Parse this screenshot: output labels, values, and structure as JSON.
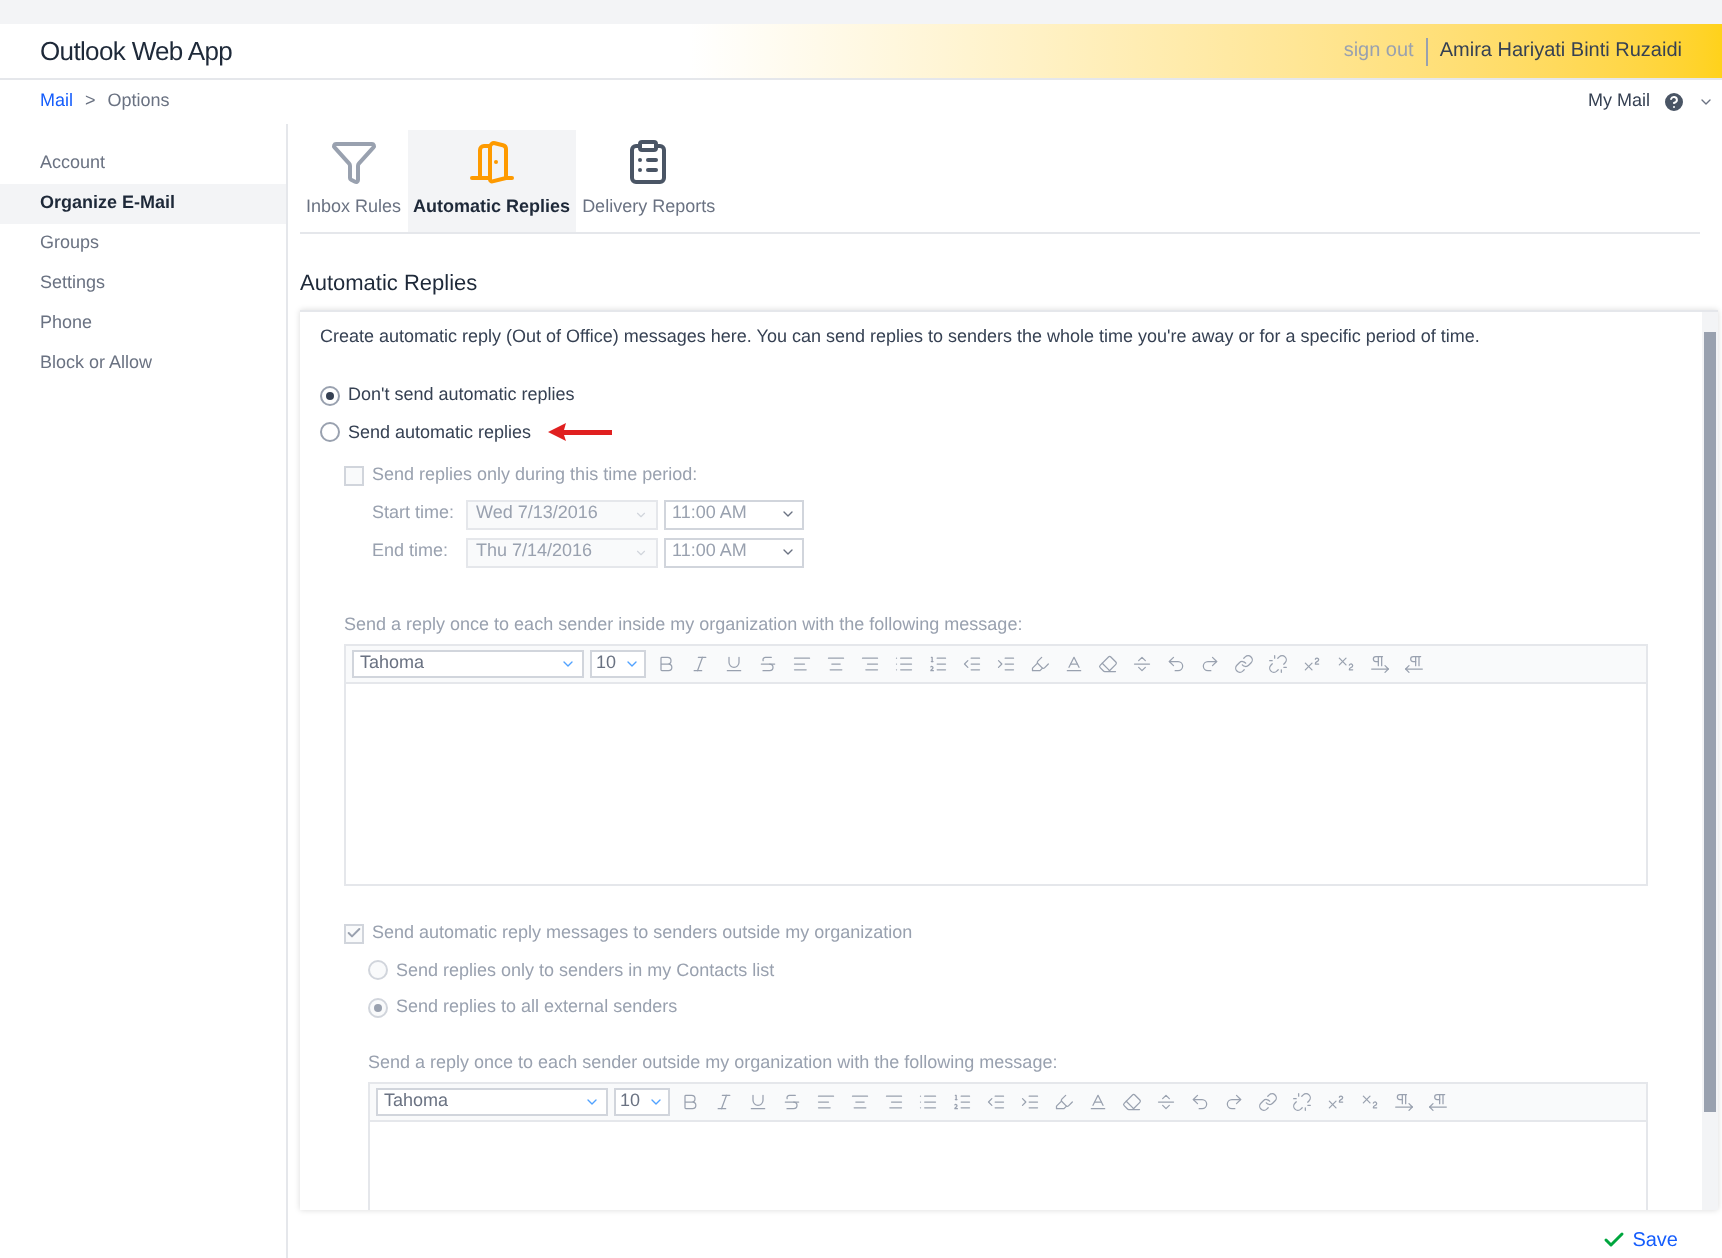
{
  "header": {
    "brand": "Outlook Web App",
    "sign_out": "sign out",
    "user": "Amira Hariyati Binti Ruzaidi"
  },
  "breadcrumb": {
    "link": "Mail",
    "separator": ">",
    "current": "Options"
  },
  "my_mail": "My Mail",
  "sidebar": {
    "items": [
      {
        "label": "Account",
        "selected": false
      },
      {
        "label": "Organize E-Mail",
        "selected": true
      },
      {
        "label": "Groups",
        "selected": false
      },
      {
        "label": "Settings",
        "selected": false
      },
      {
        "label": "Phone",
        "selected": false
      },
      {
        "label": "Block or Allow",
        "selected": false
      }
    ]
  },
  "tabs": [
    {
      "label": "Inbox Rules",
      "kind": "rules",
      "selected": false
    },
    {
      "label": "Automatic Replies",
      "kind": "replies",
      "selected": true
    },
    {
      "label": "Delivery Reports",
      "kind": "reports",
      "selected": false
    }
  ],
  "section_title": "Automatic Replies",
  "description": "Create automatic reply (Out of Office) messages here. You can send replies to senders the whole time you're away or for a specific period of time.",
  "modes": [
    {
      "label": "Don't send automatic replies",
      "selected": true
    },
    {
      "label": "Send automatic replies",
      "selected": false
    }
  ],
  "time_period": {
    "label": "Send replies only during this time period:",
    "checked": false,
    "disabled": true,
    "rows": [
      {
        "label": "Start time:",
        "date": "Wed 7/13/2016",
        "time": "11:00 AM"
      },
      {
        "label": "End time:",
        "date": "Thu 7/14/2016",
        "time": "11:00 AM"
      }
    ]
  },
  "inside": {
    "label": "Send a reply once to each sender inside my organization with the following message:",
    "disabled": true,
    "font": "Tahoma",
    "size": "10"
  },
  "outside": {
    "label": "Send automatic reply messages to senders outside my organization",
    "checked": true,
    "disabled": true,
    "options": [
      {
        "label": "Send replies only to senders in my Contacts list",
        "selected": false
      },
      {
        "label": "Send replies to all external senders",
        "selected": true
      }
    ],
    "message_label": "Send a reply once to each sender outside my organization with the following message:",
    "font": "Tahoma",
    "size": "10"
  },
  "save": "Save"
}
